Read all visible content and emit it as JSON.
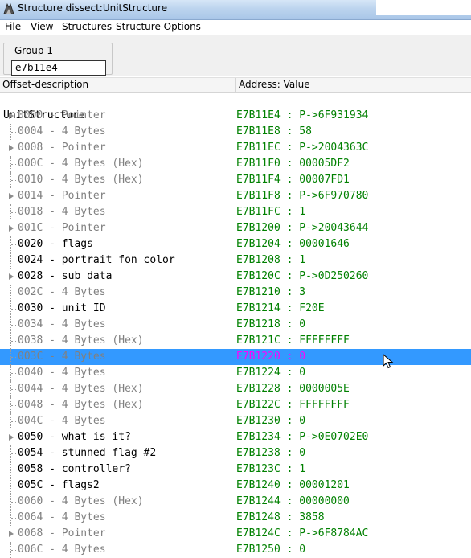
{
  "window": {
    "title": "Structure dissect:UnitStructure",
    "app_icon": "cheat-engine-icon"
  },
  "menu": {
    "items": [
      "File",
      "View",
      "Structures",
      "Structure Options"
    ]
  },
  "group": {
    "label": "Group 1",
    "address_value": "e7b11e4"
  },
  "columns": {
    "offset": "Offset-description",
    "address": "Address: Value"
  },
  "tree": {
    "root": "UnitStructure",
    "rows": [
      {
        "offset": "0000",
        "desc": "Pointer",
        "value": "E7B11E4 : P->6F931934",
        "expandable": true,
        "named": false
      },
      {
        "offset": "0004",
        "desc": "4 Bytes",
        "value": "E7B11E8 : 58",
        "expandable": false,
        "named": false
      },
      {
        "offset": "0008",
        "desc": "Pointer",
        "value": "E7B11EC : P->2004363C",
        "expandable": true,
        "named": false
      },
      {
        "offset": "000C",
        "desc": "4 Bytes (Hex)",
        "value": "E7B11F0 : 00005DF2",
        "expandable": false,
        "named": false
      },
      {
        "offset": "0010",
        "desc": "4 Bytes (Hex)",
        "value": "E7B11F4 : 00007FD1",
        "expandable": false,
        "named": false
      },
      {
        "offset": "0014",
        "desc": "Pointer",
        "value": "E7B11F8 : P->6F970780",
        "expandable": true,
        "named": false
      },
      {
        "offset": "0018",
        "desc": "4 Bytes",
        "value": "E7B11FC : 1",
        "expandable": false,
        "named": false
      },
      {
        "offset": "001C",
        "desc": "Pointer",
        "value": "E7B1200 : P->20043644",
        "expandable": true,
        "named": false
      },
      {
        "offset": "0020",
        "desc": "flags",
        "value": "E7B1204 : 00001646",
        "expandable": false,
        "named": true
      },
      {
        "offset": "0024",
        "desc": "portrait fon color",
        "value": "E7B1208 : 1",
        "expandable": false,
        "named": true
      },
      {
        "offset": "0028",
        "desc": "sub data",
        "value": "E7B120C : P->0D250260",
        "expandable": true,
        "named": true
      },
      {
        "offset": "002C",
        "desc": "4 Bytes",
        "value": "E7B1210 : 3",
        "expandable": false,
        "named": false
      },
      {
        "offset": "0030",
        "desc": "unit ID",
        "value": "E7B1214 : F20E",
        "expandable": false,
        "named": true
      },
      {
        "offset": "0034",
        "desc": "4 Bytes",
        "value": "E7B1218 : 0",
        "expandable": false,
        "named": false
      },
      {
        "offset": "0038",
        "desc": "4 Bytes (Hex)",
        "value": "E7B121C : FFFFFFFF",
        "expandable": false,
        "named": false
      },
      {
        "offset": "003C",
        "desc": "4 Bytes",
        "value": "E7B1220 : 0",
        "expandable": false,
        "named": false,
        "selected": true
      },
      {
        "offset": "0040",
        "desc": "4 Bytes",
        "value": "E7B1224 : 0",
        "expandable": false,
        "named": false
      },
      {
        "offset": "0044",
        "desc": "4 Bytes (Hex)",
        "value": "E7B1228 : 0000005E",
        "expandable": false,
        "named": false
      },
      {
        "offset": "0048",
        "desc": "4 Bytes (Hex)",
        "value": "E7B122C : FFFFFFFF",
        "expandable": false,
        "named": false
      },
      {
        "offset": "004C",
        "desc": "4 Bytes",
        "value": "E7B1230 : 0",
        "expandable": false,
        "named": false
      },
      {
        "offset": "0050",
        "desc": "what is it?",
        "value": "E7B1234 : P->0E0702E0",
        "expandable": true,
        "named": true
      },
      {
        "offset": "0054",
        "desc": "stunned flag #2",
        "value": "E7B1238 : 0",
        "expandable": false,
        "named": true
      },
      {
        "offset": "0058",
        "desc": "controller?",
        "value": "E7B123C : 1",
        "expandable": false,
        "named": true
      },
      {
        "offset": "005C",
        "desc": "flags2",
        "value": "E7B1240 : 00001201",
        "expandable": false,
        "named": true
      },
      {
        "offset": "0060",
        "desc": "4 Bytes (Hex)",
        "value": "E7B1244 : 00000000",
        "expandable": false,
        "named": false
      },
      {
        "offset": "0064",
        "desc": "4 Bytes",
        "value": "E7B1248 : 3858",
        "expandable": false,
        "named": false
      },
      {
        "offset": "0068",
        "desc": "Pointer",
        "value": "E7B124C : P->6F8784AC",
        "expandable": true,
        "named": false
      },
      {
        "offset": "006C",
        "desc": "4 Bytes",
        "value": "E7B1250 : 0",
        "expandable": false,
        "named": false
      }
    ]
  },
  "colors": {
    "value_text": "#008000",
    "selected_value_text": "#ff00ff",
    "selected_background": "#3399ff",
    "default_desc": "#808080",
    "named_desc": "#000000"
  }
}
